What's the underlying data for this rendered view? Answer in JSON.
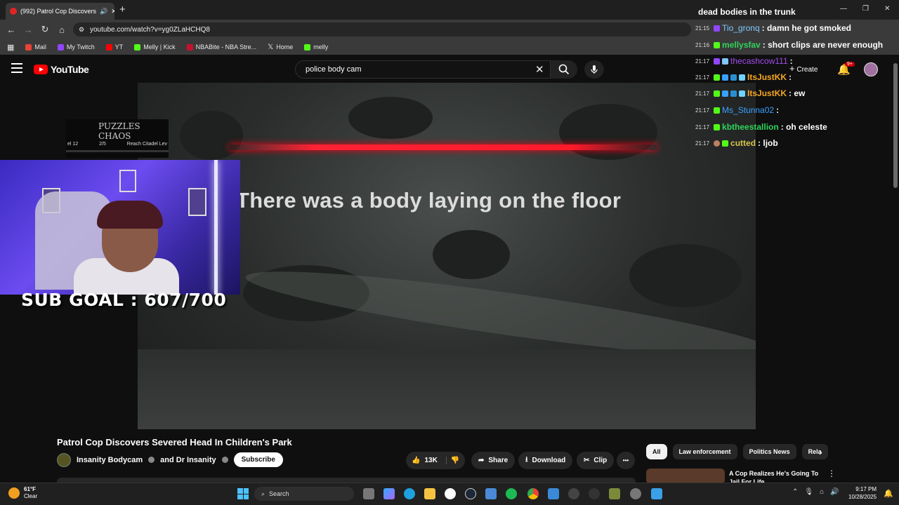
{
  "browser": {
    "tab_title": "(992) Patrol Cop Discovers",
    "new_tab": "+",
    "url": "youtube.com/watch?v=yg0ZLaHCHQ8",
    "bookmarks": [
      {
        "label": "Mail",
        "color": "#ea4335"
      },
      {
        "label": "My Twitch",
        "color": "#9146ff"
      },
      {
        "label": "YT",
        "color": "#ff0000"
      },
      {
        "label": "Melly | Kick",
        "color": "#53fc18"
      },
      {
        "label": "NBABite - NBA Stre...",
        "color": "#c8102e"
      },
      {
        "label": "Home",
        "color": "#ffffff"
      },
      {
        "label": "melly",
        "color": "#53fc18"
      }
    ]
  },
  "youtube": {
    "logo": "YouTube",
    "search_value": "police body cam",
    "create_label": "Create",
    "notif_count": "9+"
  },
  "video": {
    "caption": "There was a body laying on the floor"
  },
  "overlay": {
    "puzzles_logo": "PUZZLES CHAOS",
    "puzzles_left": "el 12",
    "puzzles_mid": "2/5",
    "puzzles_right": "Reach Citadel Lev",
    "sub_goal": "SUB GOAL : 607/700"
  },
  "chat": [
    {
      "ts": "",
      "user": "",
      "text": "dead bodies in the trunk",
      "color": "#ffffff"
    },
    {
      "ts": "21:15",
      "user": "Tio_gronq",
      "text": ": damn he got smoked",
      "color": "#7ec8ff"
    },
    {
      "ts": "21:16",
      "user": "mellysfav",
      "text": ": short clips are never enough",
      "color": "#2fd45a"
    },
    {
      "ts": "21:17",
      "user": "thecashcow111",
      "text": ":",
      "color": "#a44cf0"
    },
    {
      "ts": "21:17",
      "user": "ItsJustKK",
      "text": ":",
      "color": "#f5a623"
    },
    {
      "ts": "21:17",
      "user": "ItsJustKK",
      "text": ": ew",
      "color": "#f5a623"
    },
    {
      "ts": "21:17",
      "user": "Ms_Stunna02",
      "text": ":",
      "color": "#3aa0ff"
    },
    {
      "ts": "21:17",
      "user": "kbtheestallion",
      "text": ": oh celeste",
      "color": "#2fd45a"
    },
    {
      "ts": "21:17",
      "user": "cutted",
      "text": ": ljob",
      "color": "#d6c34a"
    }
  ],
  "below": {
    "title": "Patrol Cop Discovers Severed Head In Children's Park",
    "channel": "Insanity Bodycam",
    "channel_and": "and Dr Insanity",
    "subscribe": "Subscribe",
    "likes": "13K",
    "share": "Share",
    "download": "Download",
    "clip": "Clip",
    "more": "•••",
    "chips": [
      "All",
      "Law enforcement",
      "Politics News",
      "Rela"
    ],
    "rec_title": "A Cop Realizes He's Going To Jail For Life"
  },
  "taskbar": {
    "temp": "61°F",
    "condition": "Clear",
    "search": "Search",
    "time": "9:17 PM",
    "date": "10/28/2025"
  }
}
